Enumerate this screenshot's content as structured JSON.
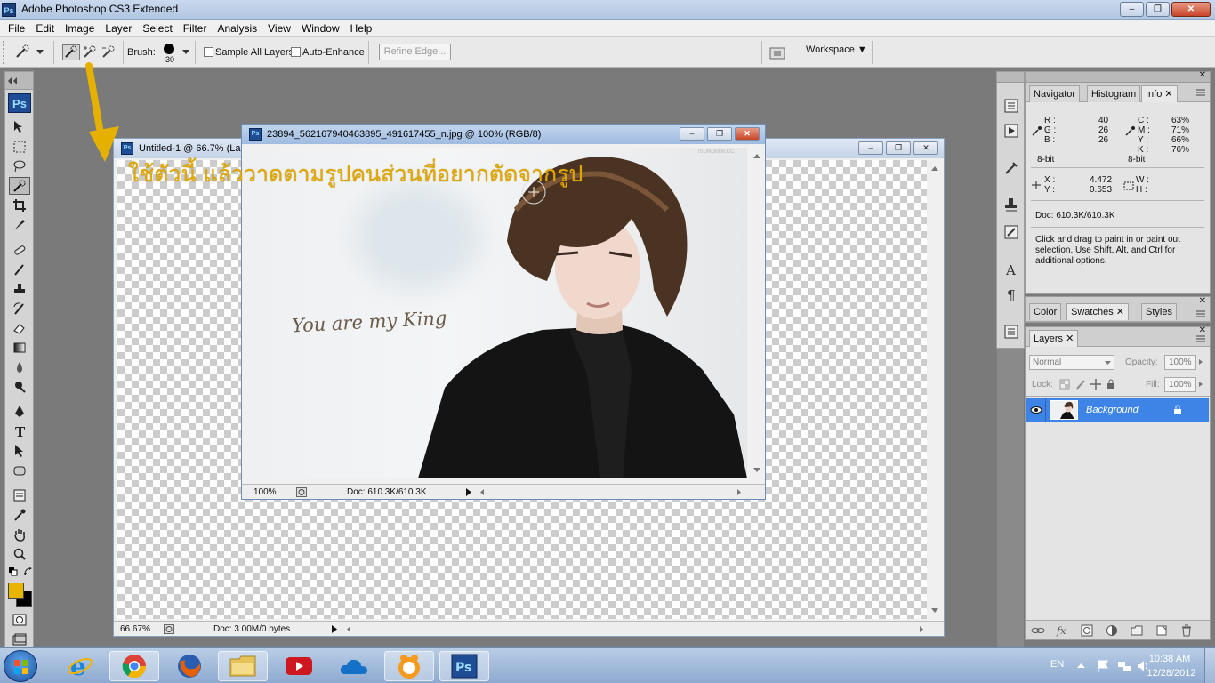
{
  "window": {
    "title": "Adobe Photoshop CS3 Extended",
    "icon_text": "Ps",
    "minimize_glyph": "–",
    "restore_glyph": "❐",
    "close_glyph": "✕"
  },
  "menu": [
    "File",
    "Edit",
    "Image",
    "Layer",
    "Select",
    "Filter",
    "Analysis",
    "View",
    "Window",
    "Help"
  ],
  "options_bar": {
    "brush_label": "Brush:",
    "brush_size": "30",
    "sample_all_layers": "Sample All Layers",
    "auto_enhance": "Auto-Enhance",
    "refine_edge": "Refine Edge...",
    "workspace": "Workspace ▼"
  },
  "toolbox": {
    "logo": "Ps",
    "foreground_color": "#e8b400",
    "background_color": "#000000"
  },
  "doc_untitled": {
    "title": "Untitled-1 @ 66.7% (La",
    "zoom": "66.67%",
    "doc_size": "Doc: 3.00M/0 bytes"
  },
  "doc_photo": {
    "title": "23894_562167940463895_491617455_n.jpg @ 100% (RGB/8)",
    "zoom": "100%",
    "doc_size": "Doc: 610.3K/610.3K",
    "cursive_text": "You are my King",
    "watermark": "ISUNGMIN.CC"
  },
  "annotation_text": "ใช้ตัวนี้ แล้ววาดตามรูปคนส่วนที่อยากตัดจากรูป",
  "info_panel": {
    "tabs": [
      "Navigator",
      "Histogram",
      "Info"
    ],
    "rgb": {
      "R": "40",
      "G": "26",
      "B": "26"
    },
    "cmyk": {
      "C": "63%",
      "M": "71%",
      "Y": "66%",
      "K": "76%"
    },
    "bit_left": "8-bit",
    "bit_right": "8-bit",
    "x": "4.472",
    "y": "0.653",
    "w": "",
    "h": "",
    "doc": "Doc: 610.3K/610.3K",
    "hint": "Click and drag to paint in or paint out selection.  Use Shift, Alt, and Ctrl for additional options."
  },
  "color_panel": {
    "tabs": [
      "Color",
      "Swatches",
      "Styles"
    ]
  },
  "layers_panel": {
    "tab": "Layers",
    "blend_mode": "Normal",
    "opacity_label": "Opacity:",
    "opacity": "100%",
    "lock_label": "Lock:",
    "fill_label": "Fill:",
    "fill": "100%",
    "layer_name": "Background"
  },
  "taskbar": {
    "language": "EN",
    "time": "10:38 AM",
    "date": "12/28/2012"
  }
}
